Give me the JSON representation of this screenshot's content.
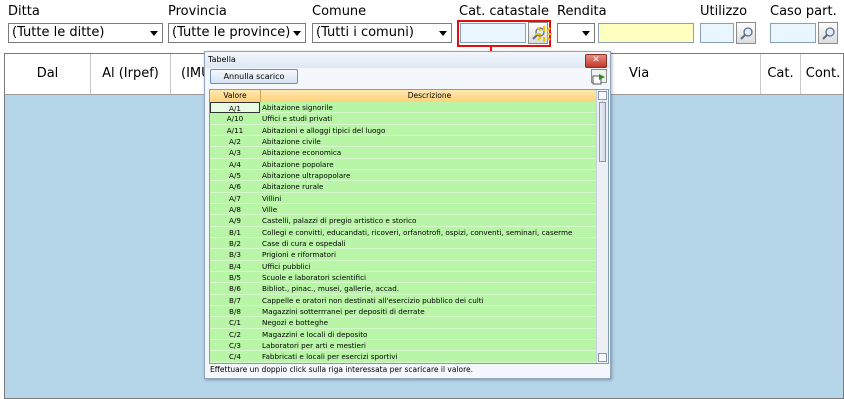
{
  "filters": {
    "ditta": {
      "label": "Ditta",
      "value": "(Tutte le ditte)"
    },
    "provincia": {
      "label": "Provincia",
      "value": "(Tutte le province)"
    },
    "comune": {
      "label": "Comune",
      "value": "(Tutti i comuni)"
    },
    "cat_catastale": {
      "label": "Cat. catastale",
      "value": ""
    },
    "rendita": {
      "label": "Rendita",
      "value": ""
    },
    "utilizzo": {
      "label": "Utilizzo",
      "value": ""
    },
    "caso_part": {
      "label": "Caso part.",
      "value": ""
    }
  },
  "grid": {
    "columns": [
      "Dal",
      "Al (Irpef)",
      "(IMU",
      "Via",
      "Cat.",
      "Cont."
    ]
  },
  "popup": {
    "title": "Tabella",
    "close_label": "✕",
    "annulla_label": "Annulla scarico",
    "col_valore": "Valore",
    "col_descrizione": "Descrizione",
    "status": "Effettuare un doppio click sulla riga interessata per scaricare il valore.",
    "rows": [
      {
        "v": "A/1",
        "d": "Abitazione signorile"
      },
      {
        "v": "A/10",
        "d": "Uffici e studi privati"
      },
      {
        "v": "A/11",
        "d": "Abitazioni e alloggi tipici del luogo"
      },
      {
        "v": "A/2",
        "d": "Abitazione civile"
      },
      {
        "v": "A/3",
        "d": "Abitazione economica"
      },
      {
        "v": "A/4",
        "d": "Abitazione popolare"
      },
      {
        "v": "A/5",
        "d": "Abitazione ultrapopolare"
      },
      {
        "v": "A/6",
        "d": "Abitazione rurale"
      },
      {
        "v": "A/7",
        "d": "Villini"
      },
      {
        "v": "A/8",
        "d": "Ville"
      },
      {
        "v": "A/9",
        "d": "Castelli, palazzi di pregio artistico e storico"
      },
      {
        "v": "B/1",
        "d": "Collegi e convitti, educandati, ricoveri, orfanotrofi, ospizi, conventi, seminari, caserme"
      },
      {
        "v": "B/2",
        "d": "Case di cura e ospedali"
      },
      {
        "v": "B/3",
        "d": "Prigioni e riformatori"
      },
      {
        "v": "B/4",
        "d": "Uffici pubblici"
      },
      {
        "v": "B/5",
        "d": "Scuole e laboratori scientifici"
      },
      {
        "v": "B/6",
        "d": "Bibliot., pinac., musei, gallerie, accad."
      },
      {
        "v": "B/7",
        "d": "Cappelle e oratori non destinati all'esercizio pubblico dei culti"
      },
      {
        "v": "B/8",
        "d": "Magazzini sotterrranei per depositi di derrate"
      },
      {
        "v": "C/1",
        "d": "Negozi e botteghe"
      },
      {
        "v": "C/2",
        "d": "Magazzini e locali di deposito"
      },
      {
        "v": "C/3",
        "d": "Laboratori per arti e mestieri"
      },
      {
        "v": "C/4",
        "d": "Fabbricati e locali per esercizi sportivi"
      }
    ]
  },
  "colors": {
    "grid_bg": "#b5d5e8",
    "row_bg": "#b8f5a6",
    "highlight_red": "#e01010",
    "rendita_input": "#ffffc0",
    "utilizzo_input": "#eaf6fd"
  }
}
